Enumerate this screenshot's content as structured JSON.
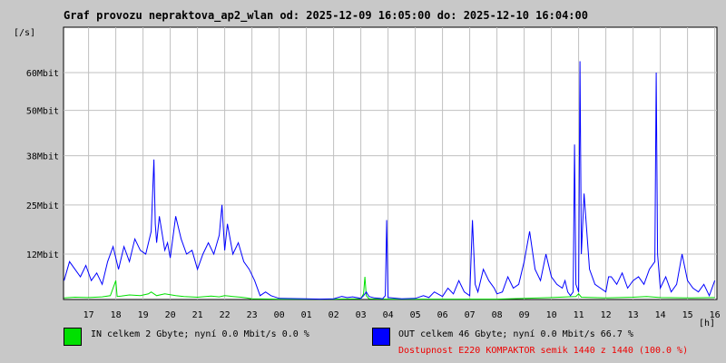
{
  "chart_data": {
    "type": "line",
    "title": "Graf provozu nepraktova_ap2_wlan od: 2025-12-09 16:05:00 do: 2025-12-10 16:04:00",
    "ylabel": "[/s]",
    "xlabel": "[h]",
    "y_ticks": [
      {
        "value": 12,
        "label": "12Mbit"
      },
      {
        "value": 25,
        "label": "25Mbit"
      },
      {
        "value": 38,
        "label": "38Mbit"
      },
      {
        "value": 50,
        "label": "50Mbit"
      },
      {
        "value": 60,
        "label": "60Mbit"
      }
    ],
    "ylim": [
      0,
      72
    ],
    "xlim": [
      16.08,
      40.08
    ],
    "x_ticks": [
      {
        "value": 17,
        "label": "17"
      },
      {
        "value": 18,
        "label": "18"
      },
      {
        "value": 19,
        "label": "19"
      },
      {
        "value": 20,
        "label": "20"
      },
      {
        "value": 21,
        "label": "21"
      },
      {
        "value": 22,
        "label": "22"
      },
      {
        "value": 23,
        "label": "23"
      },
      {
        "value": 24,
        "label": "00"
      },
      {
        "value": 25,
        "label": "01"
      },
      {
        "value": 26,
        "label": "02"
      },
      {
        "value": 27,
        "label": "03"
      },
      {
        "value": 28,
        "label": "04"
      },
      {
        "value": 29,
        "label": "05"
      },
      {
        "value": 30,
        "label": "06"
      },
      {
        "value": 31,
        "label": "07"
      },
      {
        "value": 32,
        "label": "08"
      },
      {
        "value": 33,
        "label": "09"
      },
      {
        "value": 34,
        "label": "10"
      },
      {
        "value": 35,
        "label": "11"
      },
      {
        "value": 36,
        "label": "12"
      },
      {
        "value": 37,
        "label": "13"
      },
      {
        "value": 38,
        "label": "14"
      },
      {
        "value": 39,
        "label": "15"
      },
      {
        "value": 40,
        "label": "16"
      }
    ],
    "grid": true,
    "series": [
      {
        "name": "IN",
        "color": "#00e000",
        "x": [
          16.1,
          16.5,
          17.0,
          17.5,
          17.8,
          18.0,
          18.05,
          18.2,
          18.5,
          18.9,
          19.2,
          19.3,
          19.5,
          19.8,
          20.2,
          20.5,
          21.0,
          21.5,
          21.8,
          22.0,
          22.3,
          22.6,
          22.8,
          23.0,
          24.0,
          26.0,
          27.0,
          27.1,
          27.15,
          27.2,
          27.3,
          28.0,
          30.0,
          32.0,
          33.0,
          34.0,
          34.9,
          35.0,
          35.1,
          36.0,
          37.0,
          37.5,
          38.0,
          39.0,
          40.0
        ],
        "values": [
          0.4,
          0.6,
          0.5,
          0.7,
          1.0,
          5.0,
          0.8,
          0.9,
          1.2,
          1.0,
          1.5,
          2.0,
          1.0,
          1.5,
          1.0,
          0.8,
          0.6,
          0.9,
          0.7,
          1.0,
          0.8,
          0.6,
          0.4,
          0.2,
          0.1,
          0.1,
          0.2,
          1.5,
          6.0,
          1.0,
          0.2,
          0.1,
          0.1,
          0.1,
          0.3,
          0.5,
          0.8,
          1.5,
          0.6,
          0.4,
          0.6,
          0.8,
          0.5,
          0.4,
          0.5
        ]
      },
      {
        "name": "OUT",
        "color": "#0000ff",
        "x": [
          16.1,
          16.3,
          16.5,
          16.7,
          16.9,
          17.1,
          17.3,
          17.5,
          17.7,
          17.9,
          18.1,
          18.3,
          18.5,
          18.7,
          18.9,
          19.1,
          19.3,
          19.4,
          19.45,
          19.5,
          19.6,
          19.8,
          19.9,
          20.0,
          20.2,
          20.4,
          20.6,
          20.8,
          21.0,
          21.2,
          21.4,
          21.6,
          21.8,
          21.9,
          22.0,
          22.1,
          22.3,
          22.5,
          22.7,
          22.9,
          23.1,
          23.3,
          23.5,
          23.7,
          24.0,
          25.0,
          25.5,
          26.0,
          26.3,
          26.5,
          26.7,
          27.0,
          27.1,
          27.2,
          27.3,
          27.5,
          27.7,
          27.8,
          27.9,
          27.95,
          28.0,
          28.5,
          29.0,
          29.3,
          29.5,
          29.7,
          30.0,
          30.2,
          30.4,
          30.6,
          30.8,
          31.0,
          31.1,
          31.2,
          31.3,
          31.5,
          31.7,
          31.9,
          32.0,
          32.2,
          32.4,
          32.6,
          32.8,
          33.0,
          33.2,
          33.4,
          33.6,
          33.8,
          34.0,
          34.2,
          34.4,
          34.5,
          34.6,
          34.7,
          34.8,
          34.85,
          34.9,
          35.0,
          35.05,
          35.1,
          35.2,
          35.4,
          35.6,
          35.8,
          36.0,
          36.1,
          36.2,
          36.4,
          36.6,
          36.8,
          37.0,
          37.2,
          37.4,
          37.6,
          37.8,
          37.85,
          37.9,
          38.0,
          38.2,
          38.4,
          38.6,
          38.8,
          39.0,
          39.2,
          39.4,
          39.6,
          39.8,
          40.0
        ],
        "values": [
          5.0,
          10.0,
          8.0,
          6.0,
          9.0,
          5.0,
          7.0,
          4.0,
          10.0,
          14.0,
          8.0,
          14.0,
          10.0,
          16.0,
          13.0,
          12.0,
          18.0,
          37.0,
          20.0,
          15.0,
          22.0,
          13.0,
          15.0,
          11.0,
          22.0,
          16.0,
          12.0,
          13.0,
          8.0,
          12.0,
          15.0,
          12.0,
          17.0,
          25.0,
          13.0,
          20.0,
          12.0,
          15.0,
          10.0,
          8.0,
          5.0,
          1.0,
          2.0,
          1.0,
          0.3,
          0.2,
          0.1,
          0.2,
          0.8,
          0.5,
          0.7,
          0.3,
          1.0,
          2.0,
          0.8,
          0.4,
          0.3,
          0.2,
          1.0,
          21.0,
          0.5,
          0.2,
          0.3,
          1.0,
          0.5,
          2.0,
          0.8,
          3.0,
          1.5,
          5.0,
          2.0,
          1.0,
          21.0,
          4.0,
          2.0,
          8.0,
          5.0,
          3.0,
          1.5,
          2.0,
          6.0,
          3.0,
          4.0,
          10.0,
          18.0,
          8.0,
          5.0,
          12.0,
          6.0,
          4.0,
          3.0,
          5.0,
          2.0,
          1.0,
          2.0,
          41.0,
          4.0,
          2.0,
          63.0,
          12.0,
          28.0,
          8.0,
          4.0,
          3.0,
          2.0,
          6.0,
          6.0,
          4.0,
          7.0,
          3.0,
          5.0,
          6.0,
          4.0,
          8.0,
          10.0,
          60.0,
          12.0,
          3.0,
          6.0,
          2.0,
          4.0,
          12.0,
          5.0,
          3.0,
          2.0,
          4.0,
          1.0,
          5.0
        ]
      }
    ]
  },
  "legend": {
    "in_color": "#00e000",
    "in_text": "IN celkem 2 Gbyte; nyní   0.0 Mbit/s 0.0 %",
    "out_color": "#0000ff",
    "out_text": "OUT celkem 46 Gbyte; nyní   0.0 Mbit/s 66.7 %"
  },
  "availability": {
    "text": "Dostupnost E220 KOMPAKTOR semik 1440 z 1440 (100.0 %)",
    "color": "#ee0000"
  }
}
